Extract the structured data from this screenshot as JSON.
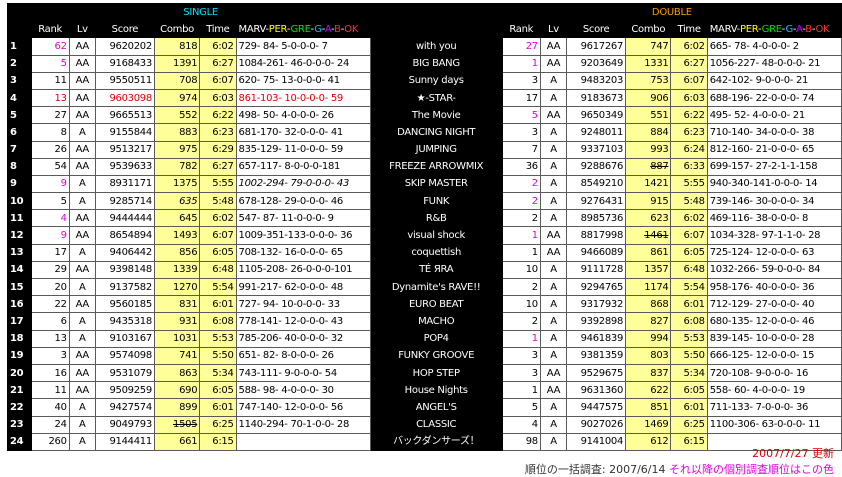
{
  "headers": {
    "single": "SINGLE",
    "double": "DOUBLE",
    "rank": "Rank",
    "lv": "Lv",
    "score": "Score",
    "combo": "Combo",
    "time": "Time",
    "judge": [
      "MARV",
      "-",
      "PER",
      "-",
      "GRE",
      "-",
      "G",
      "-",
      "A",
      "-",
      "B",
      "-",
      "OK"
    ]
  },
  "colors": {
    "marv": "#ffffff",
    "per": "#ffff00",
    "gre": "#00e000",
    "g": "#00c0ff",
    "a": "#c000ff",
    "ok": "#ff3030",
    "single_header": "#00e0ff",
    "double_header": "#ff9900",
    "highlight": "#ffff99",
    "pink": "#e000e0",
    "red": "#e00000"
  },
  "rows": [
    {
      "n": "1",
      "song": "with you",
      "s": {
        "rank": "62",
        "rank_color": "pink",
        "lv": "AA",
        "score": "9620202",
        "combo": "818",
        "time": "6:02",
        "judge": "729- 84- 5-0-0-0- 7"
      },
      "d": {
        "rank": "27",
        "rank_color": "pink",
        "lv": "AA",
        "score": "9617267",
        "combo": "747",
        "time": "6:02",
        "judge": "665- 78- 4-0-0-0- 2"
      }
    },
    {
      "n": "2",
      "song": "BIG BANG",
      "s": {
        "rank": "5",
        "rank_color": "pink",
        "lv": "AA",
        "score": "9168433",
        "combo": "1391",
        "time": "6:27",
        "judge": "1084-261- 46-0-0-0- 24"
      },
      "d": {
        "rank": "1",
        "rank_color": "pink",
        "lv": "AA",
        "score": "9203649",
        "combo": "1331",
        "time": "6:27",
        "judge": "1056-227- 48-0-0-0- 21"
      }
    },
    {
      "n": "3",
      "song": "Sunny days",
      "s": {
        "rank": "11",
        "lv": "AA",
        "score": "9550511",
        "combo": "708",
        "time": "6:07",
        "judge": "620- 75- 13-0-0-0- 41"
      },
      "d": {
        "rank": "3",
        "lv": "A",
        "score": "9483203",
        "combo": "753",
        "time": "6:07",
        "judge": "642-102- 9-0-0-0- 21"
      }
    },
    {
      "n": "4",
      "song": "★-STAR-",
      "s": {
        "rank": "13",
        "rank_color": "red",
        "lv": "AA",
        "score": "9603098",
        "score_color": "red",
        "combo": "974",
        "time": "6:03",
        "judge": "861-103- 10-0-0-0- 59",
        "judge_color": "red"
      },
      "d": {
        "rank": "17",
        "lv": "A",
        "score": "9183673",
        "combo": "906",
        "time": "6:03",
        "judge": "688-196- 22-0-0-0- 74"
      }
    },
    {
      "n": "5",
      "song": "The Movie",
      "s": {
        "rank": "27",
        "lv": "AA",
        "score": "9665513",
        "combo": "552",
        "time": "6:22",
        "judge": "498- 50- 4-0-0-0- 26"
      },
      "d": {
        "rank": "5",
        "rank_color": "pink",
        "lv": "AA",
        "score": "9650349",
        "combo": "551",
        "time": "6:22",
        "judge": "495- 52- 4-0-0-0- 21"
      }
    },
    {
      "n": "6",
      "song": "DANCING NIGHT",
      "s": {
        "rank": "8",
        "lv": "A",
        "score": "9155844",
        "combo": "883",
        "time": "6:23",
        "judge": "681-170- 32-0-0-0- 41"
      },
      "d": {
        "rank": "3",
        "lv": "A",
        "score": "9248011",
        "combo": "884",
        "time": "6:23",
        "judge": "710-140- 34-0-0-0- 38"
      }
    },
    {
      "n": "7",
      "song": "JUMPING",
      "s": {
        "rank": "26",
        "lv": "AA",
        "score": "9513217",
        "combo": "975",
        "time": "6:29",
        "judge": "835-129- 11-0-0-0- 59"
      },
      "d": {
        "rank": "7",
        "lv": "A",
        "score": "9337103",
        "combo": "993",
        "time": "6:24",
        "judge": "812-160- 21-0-0-0- 65"
      }
    },
    {
      "n": "8",
      "song": "FREEZE ARROWMIX",
      "s": {
        "rank": "54",
        "lv": "AA",
        "score": "9539633",
        "combo": "782",
        "time": "6:27",
        "judge": "657-117- 8-0-0-0-181"
      },
      "d": {
        "rank": "36",
        "lv": "A",
        "score": "9288676",
        "combo": "887",
        "combo_style": "s",
        "time": "6:33",
        "judge": "699-157- 27-2-1-1-158"
      }
    },
    {
      "n": "9",
      "song": "SKIP MASTER",
      "s": {
        "rank": "9",
        "rank_color": "pink",
        "lv": "A",
        "score": "8931171",
        "combo": "1375",
        "time": "5:55",
        "judge": "1002-294- 79-0-0-0- 43",
        "judge_style": "i"
      },
      "d": {
        "rank": "2",
        "rank_color": "pink",
        "lv": "A",
        "score": "8549210",
        "combo": "1421",
        "time": "5:55",
        "judge": "940-340-141-0-0-0- 14"
      }
    },
    {
      "n": "10",
      "song": "FUNK",
      "s": {
        "rank": "5",
        "lv": "A",
        "score": "9285714",
        "combo": "635",
        "combo_style": "i",
        "time": "5:48",
        "judge": "678-128- 29-0-0-0- 46"
      },
      "d": {
        "rank": "2",
        "rank_color": "pink",
        "lv": "A",
        "score": "9276431",
        "combo": "915",
        "time": "5:48",
        "judge": "739-146- 30-0-0-0- 34"
      }
    },
    {
      "n": "11",
      "song": "R&B",
      "s": {
        "rank": "4",
        "rank_color": "pink",
        "lv": "AA",
        "score": "9444444",
        "combo": "645",
        "time": "6:02",
        "judge": "547- 87- 11-0-0-0- 9"
      },
      "d": {
        "rank": "2",
        "lv": "A",
        "score": "8985736",
        "combo": "623",
        "time": "6:02",
        "judge": "469-116- 38-0-0-0- 8"
      }
    },
    {
      "n": "12",
      "song": "visual shock",
      "s": {
        "rank": "9",
        "rank_color": "pink",
        "lv": "AA",
        "score": "8654894",
        "combo": "1493",
        "time": "6:07",
        "judge": "1009-351-133-0-0-0- 36"
      },
      "d": {
        "rank": "1",
        "rank_color": "pink",
        "lv": "AA",
        "score": "8817998",
        "combo": "1461",
        "combo_style": "s",
        "time": "6:07",
        "judge": "1034-328- 97-1-1-0- 28"
      }
    },
    {
      "n": "13",
      "song": "coquettish",
      "s": {
        "rank": "17",
        "lv": "A",
        "score": "9406442",
        "combo": "856",
        "time": "6:05",
        "judge": "708-132- 16-0-0-0- 65"
      },
      "d": {
        "rank": "1",
        "lv": "AA",
        "score": "9466089",
        "combo": "861",
        "time": "6:05",
        "judge": "725-124- 12-0-0-0- 63"
      }
    },
    {
      "n": "14",
      "song": "TÉ ЯRA",
      "s": {
        "rank": "29",
        "lv": "AA",
        "score": "9398148",
        "combo": "1339",
        "time": "6:48",
        "judge": "1105-208- 26-0-0-0-101"
      },
      "d": {
        "rank": "10",
        "lv": "A",
        "score": "9111728",
        "combo": "1357",
        "time": "6:48",
        "judge": "1032-266- 59-0-0-0- 84"
      }
    },
    {
      "n": "15",
      "song": "Dynamite's RAVE!!",
      "s": {
        "rank": "20",
        "lv": "A",
        "score": "9137582",
        "combo": "1270",
        "time": "5:54",
        "judge": "991-217- 62-0-0-0- 48"
      },
      "d": {
        "rank": "2",
        "lv": "A",
        "score": "9294765",
        "combo": "1174",
        "time": "5:54",
        "judge": "958-176- 40-0-0-0- 36"
      }
    },
    {
      "n": "16",
      "song": "EURO BEAT",
      "s": {
        "rank": "22",
        "lv": "AA",
        "score": "9560185",
        "combo": "831",
        "time": "6:01",
        "judge": "727- 94- 10-0-0-0- 33"
      },
      "d": {
        "rank": "10",
        "lv": "A",
        "score": "9317932",
        "combo": "868",
        "time": "6:01",
        "judge": "712-129- 27-0-0-0- 40"
      }
    },
    {
      "n": "17",
      "song": "MACHO",
      "s": {
        "rank": "6",
        "lv": "A",
        "score": "9435318",
        "combo": "931",
        "time": "6:08",
        "judge": "778-141- 12-0-0-0- 43"
      },
      "d": {
        "rank": "2",
        "lv": "A",
        "score": "9392898",
        "combo": "827",
        "time": "6:08",
        "judge": "680-135- 12-0-0-0- 46"
      }
    },
    {
      "n": "18",
      "song": "POP4",
      "s": {
        "rank": "13",
        "lv": "A",
        "score": "9103167",
        "combo": "1031",
        "time": "5:53",
        "judge": "785-206- 40-0-0-0- 32"
      },
      "d": {
        "rank": "1",
        "rank_color": "pink",
        "lv": "A",
        "score": "9461839",
        "combo": "994",
        "time": "5:53",
        "judge": "839-145- 10-0-0-0- 28"
      }
    },
    {
      "n": "19",
      "song": "FUNKY GROOVE",
      "s": {
        "rank": "3",
        "lv": "AA",
        "score": "9574098",
        "combo": "741",
        "time": "5:50",
        "judge": "651- 82- 8-0-0-0- 26"
      },
      "d": {
        "rank": "3",
        "lv": "A",
        "score": "9381359",
        "combo": "803",
        "time": "5:50",
        "judge": "666-125- 12-0-0-0- 15"
      }
    },
    {
      "n": "20",
      "song": "HOP STEP",
      "s": {
        "rank": "16",
        "lv": "AA",
        "score": "9531079",
        "combo": "863",
        "time": "5:34",
        "judge": "743-111- 9-0-0-0- 54"
      },
      "d": {
        "rank": "3",
        "lv": "AA",
        "score": "9529675",
        "combo": "837",
        "time": "5:34",
        "judge": "720-108- 9-0-0-0- 16"
      }
    },
    {
      "n": "21",
      "song": "House Nights",
      "s": {
        "rank": "11",
        "lv": "AA",
        "score": "9509259",
        "combo": "690",
        "time": "6:05",
        "judge": "588- 98- 4-0-0-0- 30"
      },
      "d": {
        "rank": "1",
        "lv": "AA",
        "score": "9631360",
        "combo": "622",
        "time": "6:05",
        "judge": "558- 60- 4-0-0-0- 19"
      }
    },
    {
      "n": "22",
      "song": "ANGEL'S",
      "s": {
        "rank": "40",
        "lv": "A",
        "score": "9427574",
        "combo": "899",
        "time": "6:01",
        "judge": "747-140- 12-0-0-0- 56"
      },
      "d": {
        "rank": "5",
        "lv": "A",
        "score": "9447575",
        "combo": "851",
        "time": "6:01",
        "judge": "711-133- 7-0-0-0- 36"
      }
    },
    {
      "n": "23",
      "song": "CLASSIC",
      "s": {
        "rank": "24",
        "lv": "A",
        "score": "9049793",
        "combo": "1505",
        "combo_style": "s",
        "time": "6:25",
        "judge": "1140-294- 70-1-0-0- 28"
      },
      "d": {
        "rank": "4",
        "lv": "A",
        "score": "9027026",
        "combo": "1469",
        "time": "6:25",
        "judge": "1100-306- 63-0-0-0- 11"
      }
    },
    {
      "n": "24",
      "song": "バックダンサーズ！",
      "s": {
        "rank": "260",
        "lv": "A",
        "score": "9144411",
        "combo": "661",
        "time": "6:15",
        "judge": ""
      },
      "d": {
        "rank": "98",
        "lv": "A",
        "score": "9141004",
        "combo": "612",
        "time": "6:15",
        "judge": ""
      }
    }
  ],
  "footer": {
    "updated": "2007/7/27 更新",
    "rank_note_prefix": "順位の一括調査: 2007/6/14",
    "rank_note_suffix": "それ以降の個別調査順位はこの色"
  }
}
